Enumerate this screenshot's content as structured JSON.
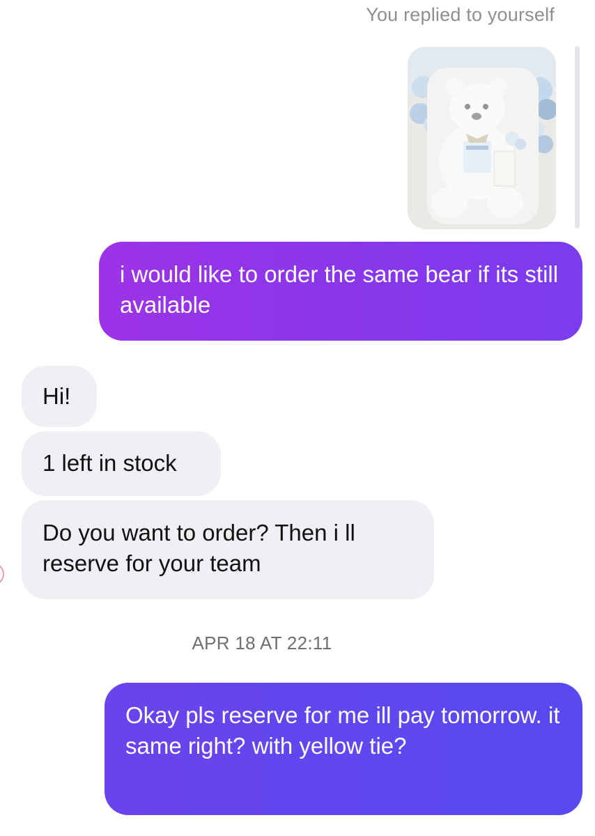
{
  "thread": {
    "reply_context": "You replied to yourself",
    "timestamp": "APR 18 AT 22:11",
    "colors": {
      "outgoing_start": "#9d33e6",
      "outgoing_end": "#5849f0",
      "incoming_bubble": "#efeff4",
      "meta_text": "#8e8e93"
    }
  },
  "messages": [
    {
      "direction": "outgoing",
      "text": "i would like to order the same bear if its still available"
    },
    {
      "direction": "incoming",
      "text": "Hi!"
    },
    {
      "direction": "incoming",
      "text": "1 left in stock"
    },
    {
      "direction": "incoming",
      "text": "Do you want to order? Then i ll reserve for your team"
    },
    {
      "direction": "outgoing",
      "text": "Okay pls reserve for me ill pay tomorrow. it same right? with yellow tie?"
    }
  ]
}
